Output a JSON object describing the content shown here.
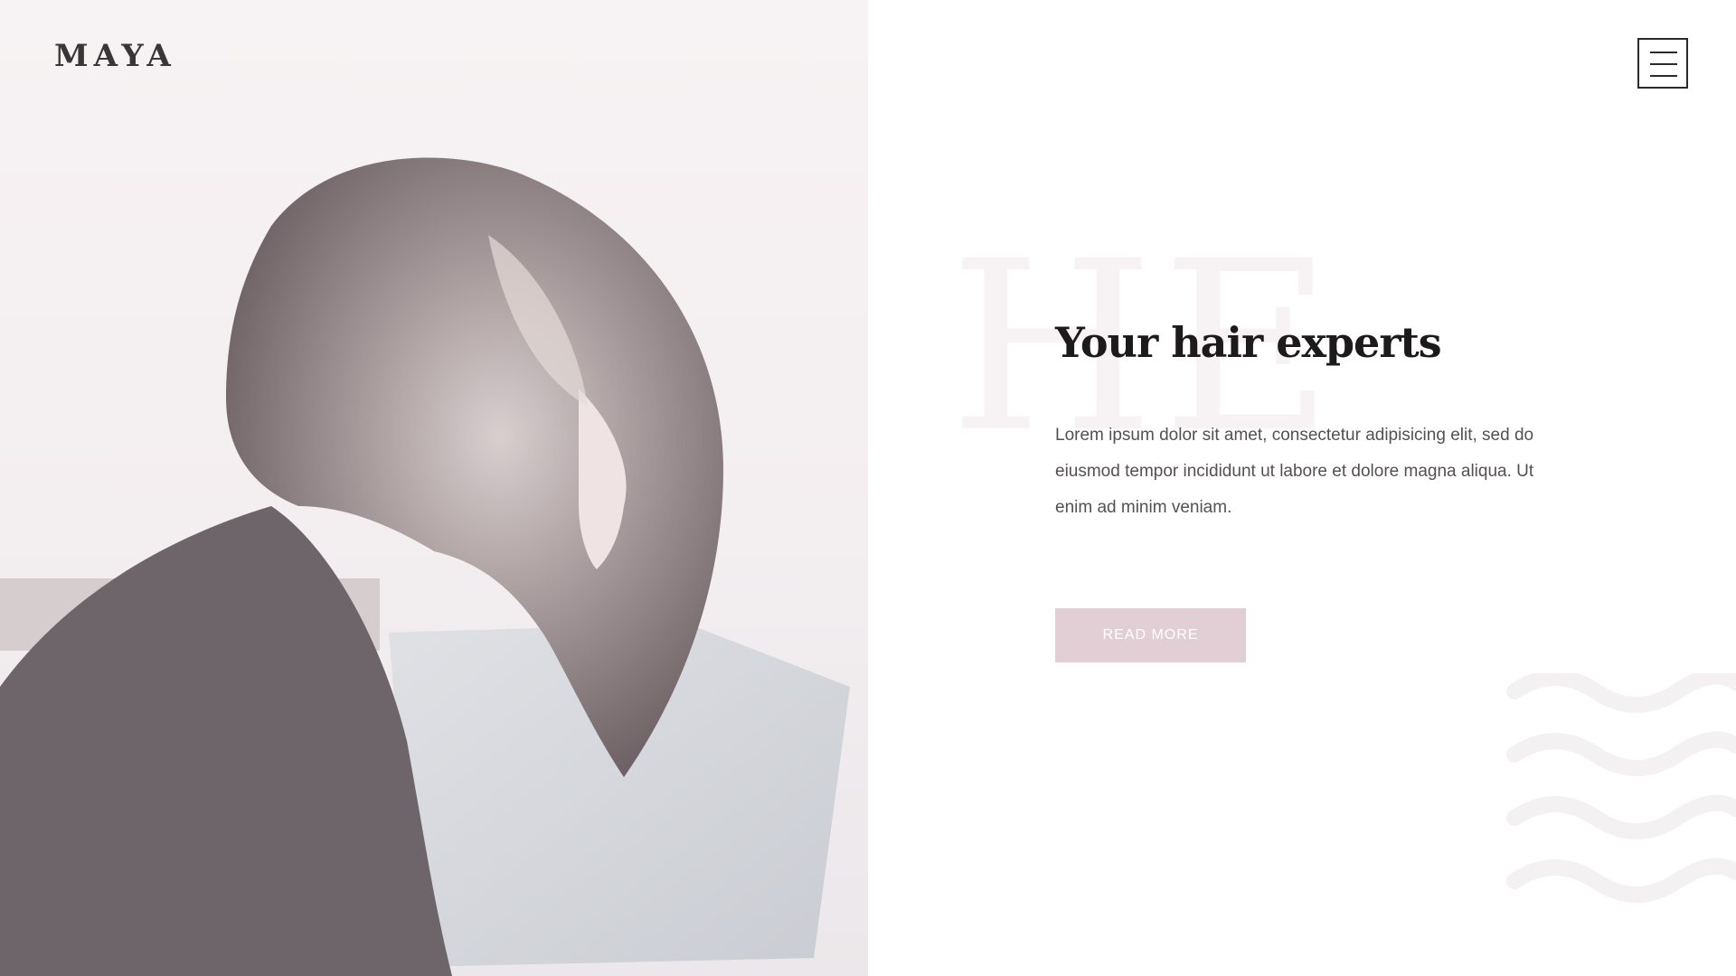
{
  "brand": {
    "logo_text": "MAYA"
  },
  "header": {
    "menu_icon": "hamburger-menu-icon"
  },
  "hero": {
    "watermark_text": "HE",
    "headline": "Your hair experts",
    "body": "Lorem ipsum dolor sit amet, consectetur adipisicing elit, sed do eiusmod tempor incididunt ut labore et dolore magna aliqua. Ut enim ad minim veniam.",
    "cta_label": "READ MORE"
  },
  "colors": {
    "left_panel_bg": "#f6f1f2",
    "cta_bg": "#e2ced5",
    "headline": "#1c1a1b",
    "body_text": "#555052"
  }
}
